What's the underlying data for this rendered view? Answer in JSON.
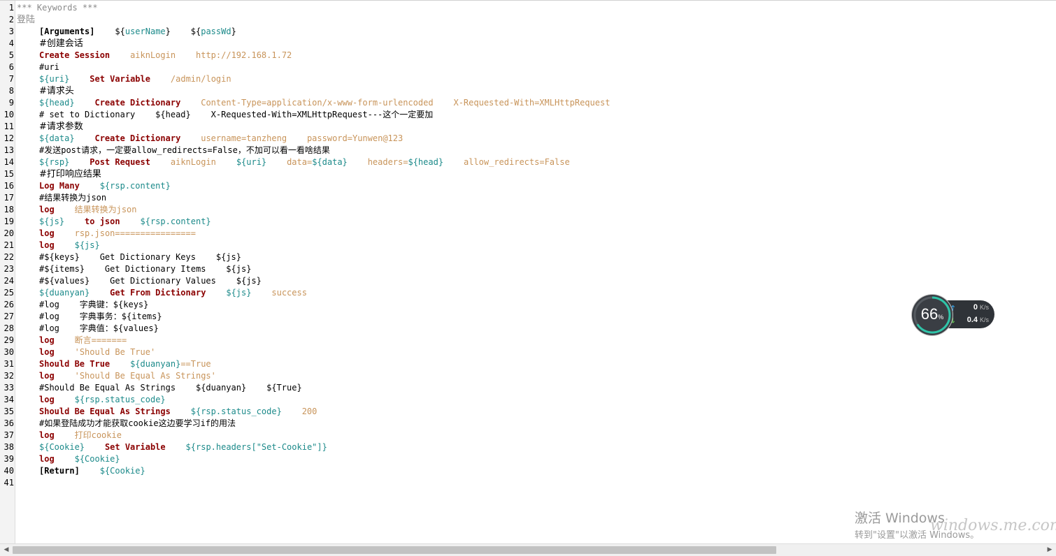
{
  "editor": {
    "lines": [
      {
        "n": "1",
        "tokens": [
          {
            "t": "*** Keywords ***",
            "c": "comment"
          }
        ]
      },
      {
        "n": "2",
        "tokens": [
          {
            "t": "登陆",
            "c": "comment",
            "cjk": true
          }
        ]
      },
      {
        "n": "3",
        "indent": 4,
        "tokens": [
          {
            "t": "[Arguments]",
            "c": "bracket"
          },
          {
            "t": "    ",
            "c": "plain"
          },
          {
            "t": "${",
            "c": "plain"
          },
          {
            "t": "userName",
            "c": "var"
          },
          {
            "t": "}",
            "c": "plain"
          },
          {
            "t": "    ",
            "c": "plain"
          },
          {
            "t": "${",
            "c": "plain"
          },
          {
            "t": "passWd",
            "c": "var"
          },
          {
            "t": "}",
            "c": "plain"
          }
        ]
      },
      {
        "n": "4",
        "indent": 4,
        "tokens": [
          {
            "t": "#创建会话",
            "c": "plain",
            "cjk": true
          }
        ]
      },
      {
        "n": "5",
        "indent": 4,
        "tokens": [
          {
            "t": "Create Session",
            "c": "kw"
          },
          {
            "t": "    ",
            "c": "plain"
          },
          {
            "t": "aiknLogin",
            "c": "arg"
          },
          {
            "t": "    ",
            "c": "plain"
          },
          {
            "t": "http://192.168.1.72",
            "c": "arg"
          }
        ]
      },
      {
        "n": "6",
        "indent": 4,
        "tokens": [
          {
            "t": "#uri",
            "c": "plain"
          }
        ]
      },
      {
        "n": "7",
        "indent": 4,
        "tokens": [
          {
            "t": "${",
            "c": "var"
          },
          {
            "t": "uri",
            "c": "var"
          },
          {
            "t": "}",
            "c": "var"
          },
          {
            "t": "    ",
            "c": "plain"
          },
          {
            "t": "Set Variable",
            "c": "kw"
          },
          {
            "t": "    ",
            "c": "plain"
          },
          {
            "t": "/admin/login",
            "c": "arg"
          }
        ]
      },
      {
        "n": "8",
        "indent": 4,
        "tokens": [
          {
            "t": "#请求头",
            "c": "plain",
            "cjk": true
          }
        ]
      },
      {
        "n": "9",
        "indent": 4,
        "tokens": [
          {
            "t": "${head}",
            "c": "var"
          },
          {
            "t": "    ",
            "c": "plain"
          },
          {
            "t": "Create Dictionary",
            "c": "kw"
          },
          {
            "t": "    ",
            "c": "plain"
          },
          {
            "t": "Content-Type=application/x-www-form-urlencoded",
            "c": "arg"
          },
          {
            "t": "    ",
            "c": "plain"
          },
          {
            "t": "X-Requested-With=XMLHttpRequest",
            "c": "arg"
          }
        ]
      },
      {
        "n": "10",
        "indent": 4,
        "tokens": [
          {
            "t": "# set to Dictionary    ${head}    X-Requested-With=XMLHttpRequest---这个一定要加",
            "c": "plain"
          }
        ]
      },
      {
        "n": "11",
        "indent": 4,
        "tokens": [
          {
            "t": "#请求参数",
            "c": "plain",
            "cjk": true
          }
        ]
      },
      {
        "n": "12",
        "indent": 4,
        "tokens": [
          {
            "t": "${data}",
            "c": "var"
          },
          {
            "t": "    ",
            "c": "plain"
          },
          {
            "t": "Create Dictionary",
            "c": "kw"
          },
          {
            "t": "    ",
            "c": "plain"
          },
          {
            "t": "username=tanzheng",
            "c": "arg"
          },
          {
            "t": "    ",
            "c": "plain"
          },
          {
            "t": "password=Yunwen@123",
            "c": "arg"
          }
        ]
      },
      {
        "n": "13",
        "indent": 4,
        "tokens": [
          {
            "t": "#发送post请求，一定要allow_redirects=False，不加可以看一看啥结果",
            "c": "plain"
          }
        ]
      },
      {
        "n": "14",
        "indent": 4,
        "tokens": [
          {
            "t": "${rsp}",
            "c": "var"
          },
          {
            "t": "    ",
            "c": "plain"
          },
          {
            "t": "Post Request",
            "c": "kw"
          },
          {
            "t": "    ",
            "c": "plain"
          },
          {
            "t": "aiknLogin",
            "c": "arg"
          },
          {
            "t": "    ",
            "c": "plain"
          },
          {
            "t": "${uri}",
            "c": "var"
          },
          {
            "t": "    ",
            "c": "plain"
          },
          {
            "t": "data=",
            "c": "arg"
          },
          {
            "t": "${data}",
            "c": "var"
          },
          {
            "t": "    ",
            "c": "plain"
          },
          {
            "t": "headers=",
            "c": "arg"
          },
          {
            "t": "${head}",
            "c": "var"
          },
          {
            "t": "    ",
            "c": "plain"
          },
          {
            "t": "allow_redirects=False",
            "c": "arg"
          }
        ]
      },
      {
        "n": "15",
        "indent": 4,
        "tokens": [
          {
            "t": "#打印响应结果",
            "c": "plain",
            "cjk": true
          }
        ]
      },
      {
        "n": "16",
        "indent": 4,
        "tokens": [
          {
            "t": "Log Many",
            "c": "kw"
          },
          {
            "t": "    ",
            "c": "plain"
          },
          {
            "t": "${rsp.content}",
            "c": "var"
          }
        ]
      },
      {
        "n": "17",
        "indent": 4,
        "tokens": [
          {
            "t": "#结果转换为json",
            "c": "plain"
          }
        ]
      },
      {
        "n": "18",
        "indent": 4,
        "tokens": [
          {
            "t": "log",
            "c": "kw"
          },
          {
            "t": "    ",
            "c": "plain"
          },
          {
            "t": "结果转换为json",
            "c": "arg"
          }
        ]
      },
      {
        "n": "19",
        "indent": 4,
        "tokens": [
          {
            "t": "${js}",
            "c": "var"
          },
          {
            "t": "    ",
            "c": "plain"
          },
          {
            "t": "to json",
            "c": "kw"
          },
          {
            "t": "    ",
            "c": "plain"
          },
          {
            "t": "${rsp.content}",
            "c": "var"
          }
        ]
      },
      {
        "n": "20",
        "indent": 4,
        "tokens": [
          {
            "t": "log",
            "c": "kw"
          },
          {
            "t": "    ",
            "c": "plain"
          },
          {
            "t": "rsp.json================",
            "c": "arg"
          }
        ]
      },
      {
        "n": "21",
        "indent": 4,
        "tokens": [
          {
            "t": "log",
            "c": "kw"
          },
          {
            "t": "    ",
            "c": "plain"
          },
          {
            "t": "${js}",
            "c": "var"
          }
        ]
      },
      {
        "n": "22",
        "indent": 4,
        "tokens": [
          {
            "t": "#${keys}    Get Dictionary Keys    ${js}",
            "c": "plain"
          }
        ]
      },
      {
        "n": "23",
        "indent": 4,
        "tokens": [
          {
            "t": "#${items}    Get Dictionary Items    ${js}",
            "c": "plain"
          }
        ]
      },
      {
        "n": "24",
        "indent": 4,
        "tokens": [
          {
            "t": "#${values}    Get Dictionary Values    ${js}",
            "c": "plain"
          }
        ]
      },
      {
        "n": "25",
        "indent": 4,
        "tokens": [
          {
            "t": "${duanyan}",
            "c": "var"
          },
          {
            "t": "    ",
            "c": "plain"
          },
          {
            "t": "Get From Dictionary",
            "c": "kw"
          },
          {
            "t": "    ",
            "c": "plain"
          },
          {
            "t": "${js}",
            "c": "var"
          },
          {
            "t": "    ",
            "c": "plain"
          },
          {
            "t": "success",
            "c": "arg"
          }
        ]
      },
      {
        "n": "26",
        "indent": 4,
        "tokens": [
          {
            "t": "#log    字典键：${keys}",
            "c": "plain"
          }
        ]
      },
      {
        "n": "27",
        "indent": 4,
        "tokens": [
          {
            "t": "#log    字典事务：${items}",
            "c": "plain"
          }
        ]
      },
      {
        "n": "28",
        "indent": 4,
        "tokens": [
          {
            "t": "#log    字典值：${values}",
            "c": "plain"
          }
        ]
      },
      {
        "n": "29",
        "indent": 4,
        "tokens": [
          {
            "t": "log",
            "c": "kw"
          },
          {
            "t": "    ",
            "c": "plain"
          },
          {
            "t": "断言=======",
            "c": "arg"
          }
        ]
      },
      {
        "n": "30",
        "indent": 4,
        "tokens": [
          {
            "t": "log",
            "c": "kw"
          },
          {
            "t": "    ",
            "c": "plain"
          },
          {
            "t": "'Should Be True'",
            "c": "arg"
          }
        ]
      },
      {
        "n": "31",
        "indent": 4,
        "tokens": [
          {
            "t": "Should Be True",
            "c": "kw"
          },
          {
            "t": "    ",
            "c": "plain"
          },
          {
            "t": "${duanyan}",
            "c": "var"
          },
          {
            "t": "==True",
            "c": "arg"
          }
        ]
      },
      {
        "n": "32",
        "indent": 4,
        "tokens": [
          {
            "t": "log",
            "c": "kw"
          },
          {
            "t": "    ",
            "c": "plain"
          },
          {
            "t": "'Should Be Equal As Strings'",
            "c": "arg"
          }
        ]
      },
      {
        "n": "33",
        "indent": 4,
        "tokens": [
          {
            "t": "#Should Be Equal As Strings    ${duanyan}    ${True}",
            "c": "plain"
          }
        ]
      },
      {
        "n": "34",
        "indent": 4,
        "tokens": [
          {
            "t": "log",
            "c": "kw"
          },
          {
            "t": "    ",
            "c": "plain"
          },
          {
            "t": "${rsp.status_code}",
            "c": "var"
          }
        ]
      },
      {
        "n": "35",
        "indent": 4,
        "tokens": [
          {
            "t": "Should Be Equal As Strings",
            "c": "kw"
          },
          {
            "t": "    ",
            "c": "plain"
          },
          {
            "t": "${rsp.status_code}",
            "c": "var"
          },
          {
            "t": "    ",
            "c": "plain"
          },
          {
            "t": "200",
            "c": "arg"
          }
        ]
      },
      {
        "n": "36",
        "indent": 4,
        "tokens": [
          {
            "t": "#如果登陆成功才能获取cookie这边要学习if的用法",
            "c": "plain"
          }
        ]
      },
      {
        "n": "37",
        "indent": 4,
        "tokens": [
          {
            "t": "log",
            "c": "kw"
          },
          {
            "t": "    ",
            "c": "plain"
          },
          {
            "t": "打印cookie",
            "c": "arg"
          }
        ]
      },
      {
        "n": "38",
        "indent": 4,
        "tokens": [
          {
            "t": "${Cookie}",
            "c": "var"
          },
          {
            "t": "    ",
            "c": "plain"
          },
          {
            "t": "Set Variable",
            "c": "kw"
          },
          {
            "t": "    ",
            "c": "plain"
          },
          {
            "t": "${rsp.headers[\"Set-Cookie\"]}",
            "c": "var"
          }
        ]
      },
      {
        "n": "39",
        "indent": 4,
        "tokens": [
          {
            "t": "log",
            "c": "kw"
          },
          {
            "t": "    ",
            "c": "plain"
          },
          {
            "t": "${Cookie}",
            "c": "var"
          }
        ]
      },
      {
        "n": "40",
        "indent": 4,
        "tokens": [
          {
            "t": "[Return]",
            "c": "bracket"
          },
          {
            "t": "    ",
            "c": "plain"
          },
          {
            "t": "${Cookie}",
            "c": "var"
          }
        ]
      },
      {
        "n": "41",
        "tokens": []
      }
    ]
  },
  "net_monitor": {
    "cpu_value": "66",
    "cpu_unit": "%",
    "cpu_fraction": 0.66,
    "upload_value": "0",
    "upload_unit": "K/s",
    "download_value": "0.4",
    "download_unit": "K/s",
    "up_icon": "arrow-up-icon",
    "down_icon": "arrow-down-icon"
  },
  "activation": {
    "title": "激活 Windows",
    "subtitle": "转到\"设置\"以激活 Windows。"
  },
  "site_watermark": "windows.me.com",
  "colors": {
    "keyword": "#8b0000",
    "variable": "#1c8a8a",
    "argument": "#c8945a",
    "comment": "#8a8a8a"
  }
}
